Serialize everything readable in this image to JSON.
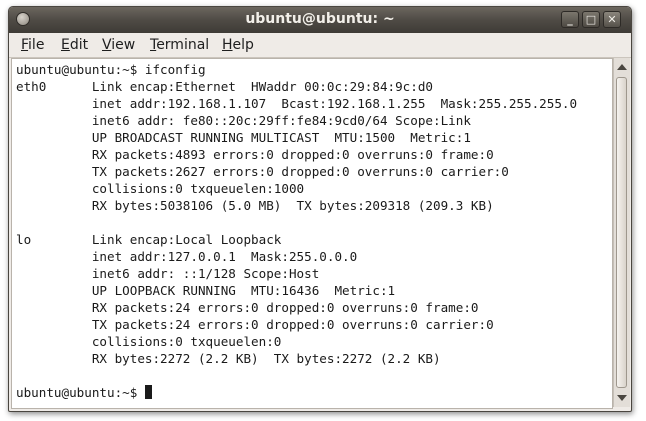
{
  "window": {
    "title": "ubuntu@ubuntu: ~",
    "minimize_glyph": "_",
    "maximize_glyph": "□",
    "close_glyph": "✕"
  },
  "menu": {
    "items": [
      {
        "label": "File",
        "mnemonic": "F",
        "rest": "ile"
      },
      {
        "label": "Edit",
        "mnemonic": "E",
        "rest": "dit"
      },
      {
        "label": "View",
        "mnemonic": "V",
        "rest": "iew"
      },
      {
        "label": "Terminal",
        "mnemonic": "T",
        "rest": "erminal"
      },
      {
        "label": "Help",
        "mnemonic": "H",
        "rest": "elp"
      }
    ]
  },
  "terminal": {
    "lines": [
      "ubuntu@ubuntu:~$ ifconfig",
      "eth0      Link encap:Ethernet  HWaddr 00:0c:29:84:9c:d0",
      "          inet addr:192.168.1.107  Bcast:192.168.1.255  Mask:255.255.255.0",
      "          inet6 addr: fe80::20c:29ff:fe84:9cd0/64 Scope:Link",
      "          UP BROADCAST RUNNING MULTICAST  MTU:1500  Metric:1",
      "          RX packets:4893 errors:0 dropped:0 overruns:0 frame:0",
      "          TX packets:2627 errors:0 dropped:0 overruns:0 carrier:0",
      "          collisions:0 txqueuelen:1000",
      "          RX bytes:5038106 (5.0 MB)  TX bytes:209318 (209.3 KB)",
      "",
      "lo        Link encap:Local Loopback",
      "          inet addr:127.0.0.1  Mask:255.0.0.0",
      "          inet6 addr: ::1/128 Scope:Host",
      "          UP LOOPBACK RUNNING  MTU:16436  Metric:1",
      "          RX packets:24 errors:0 dropped:0 overruns:0 frame:0",
      "          TX packets:24 errors:0 dropped:0 overruns:0 carrier:0",
      "          collisions:0 txqueuelen:0",
      "          RX bytes:2272 (2.2 KB)  TX bytes:2272 (2.2 KB)",
      ""
    ],
    "prompt": "ubuntu@ubuntu:~$ "
  }
}
